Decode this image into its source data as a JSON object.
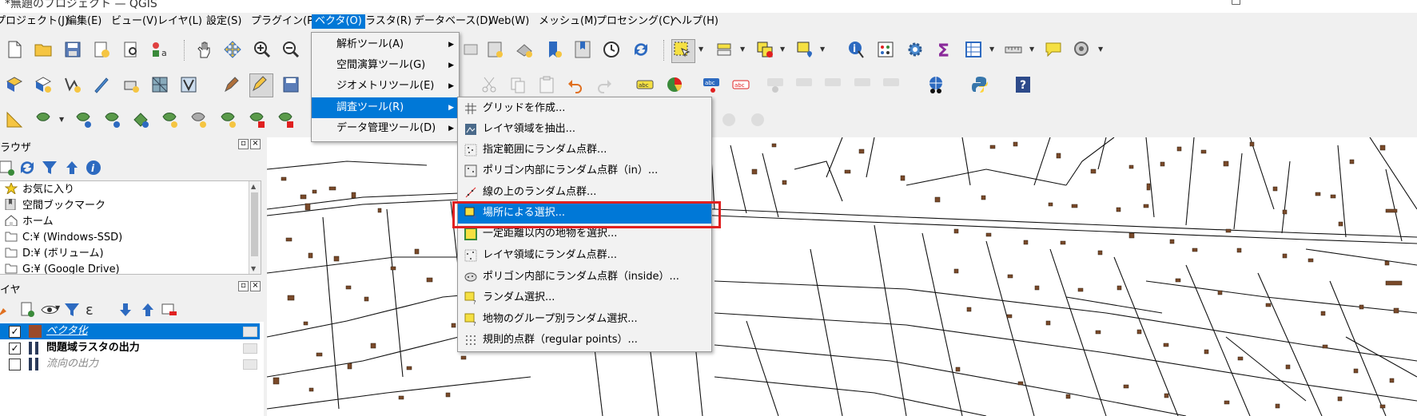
{
  "window": {
    "title": "*無題のプロジェクト — QGIS",
    "minimize": "─",
    "restore": "□"
  },
  "menubar": {
    "items": [
      "プロジェクト(J)",
      "編集(E)",
      "ビュー(V)",
      "レイヤ(L)",
      "設定(S)",
      "プラグイン(P)",
      "ベクタ(O)",
      "ラスタ(R)",
      "データベース(D)",
      "Web(W)",
      "メッシュ(M)",
      "プロセシング(C)",
      "ヘルプ(H)"
    ],
    "active_index": 6
  },
  "vector_menu": {
    "items": [
      {
        "label": "解析ツール(A)",
        "has_submenu": true
      },
      {
        "label": "空間演算ツール(G)",
        "has_submenu": true
      },
      {
        "label": "ジオメトリツール(E)",
        "has_submenu": true
      },
      {
        "label": "調査ツール(R)",
        "has_submenu": true,
        "highlighted": true
      },
      {
        "label": "データ管理ツール(D)",
        "has_submenu": true
      }
    ]
  },
  "research_submenu": {
    "items": [
      {
        "label": "グリッドを作成...",
        "icon": "grid-icon"
      },
      {
        "label": "レイヤ領域を抽出...",
        "icon": "layer-extent-icon"
      },
      {
        "label": "指定範囲にランダム点群...",
        "icon": "random-points-extent-icon"
      },
      {
        "label": "ポリゴン内部にランダム点群（in）...",
        "icon": "random-points-polygon-icon"
      },
      {
        "label": "線の上のランダム点群...",
        "icon": "random-points-line-icon"
      },
      {
        "label": "場所による選択...",
        "icon": "select-by-location-icon",
        "highlighted": true
      },
      {
        "label": "一定距離以内の地物を選択...",
        "icon": "select-within-distance-icon"
      },
      {
        "label": "レイヤ領域にランダム点群...",
        "icon": "random-points-layer-icon"
      },
      {
        "label": "ポリゴン内部にランダム点群（inside）...",
        "icon": "random-points-inside-icon"
      },
      {
        "label": "ランダム選択...",
        "icon": "random-select-icon"
      },
      {
        "label": "地物のグループ別ランダム選択...",
        "icon": "random-select-group-icon"
      },
      {
        "label": "規則的点群（regular points）...",
        "icon": "regular-points-icon"
      }
    ]
  },
  "browser_panel": {
    "title": "ラウザ",
    "items": [
      {
        "label": "お気に入り",
        "icon": "star-icon"
      },
      {
        "label": "空間ブックマーク",
        "icon": "bookmark-icon"
      },
      {
        "label": "ホーム",
        "icon": "home-icon"
      },
      {
        "label": "C:¥ (Windows-SSD)",
        "icon": "folder-icon"
      },
      {
        "label": "D:¥ (ボリューム)",
        "icon": "folder-icon"
      },
      {
        "label": "G:¥ (Google Drive)",
        "icon": "folder-icon"
      }
    ]
  },
  "layers_panel": {
    "title": "イヤ",
    "layers": [
      {
        "label": "ベクタ化",
        "checked": true,
        "selected": true
      },
      {
        "label": "問題域ラスタの出力",
        "checked": true,
        "selected": false
      },
      {
        "label": "流向の出力",
        "checked": false,
        "selected": false
      }
    ]
  },
  "colors": {
    "accent": "#0078d7",
    "highlight_box": "#e02020",
    "building_fill": "#7a4a2a"
  }
}
